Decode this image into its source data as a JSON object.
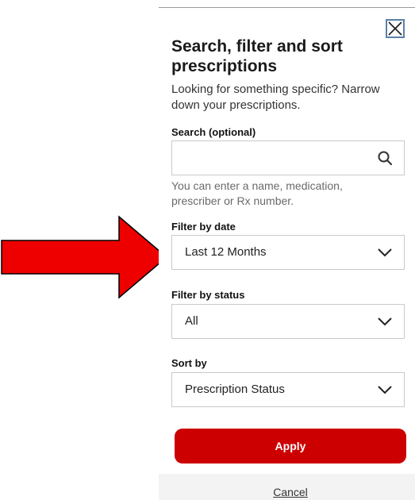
{
  "annotation": {
    "icon": "red-arrow-right-icon",
    "color": "#ee0000"
  },
  "panel": {
    "close_icon": "close-icon",
    "title": "Search, filter and sort prescriptions",
    "subtitle": "Looking for something specific? Narrow down your prescriptions.",
    "search": {
      "label": "Search (optional)",
      "value": "",
      "placeholder": "",
      "icon": "search-icon",
      "hint": "You can enter a name, medication, prescriber or Rx number."
    },
    "filter_date": {
      "label": "Filter by date",
      "selected": "Last 12 Months"
    },
    "filter_status": {
      "label": "Filter by status",
      "selected": "All"
    },
    "sort": {
      "label": "Sort by",
      "selected": "Prescription Status"
    },
    "apply_label": "Apply",
    "cancel_label": "Cancel",
    "accent_color": "#cc0000"
  }
}
